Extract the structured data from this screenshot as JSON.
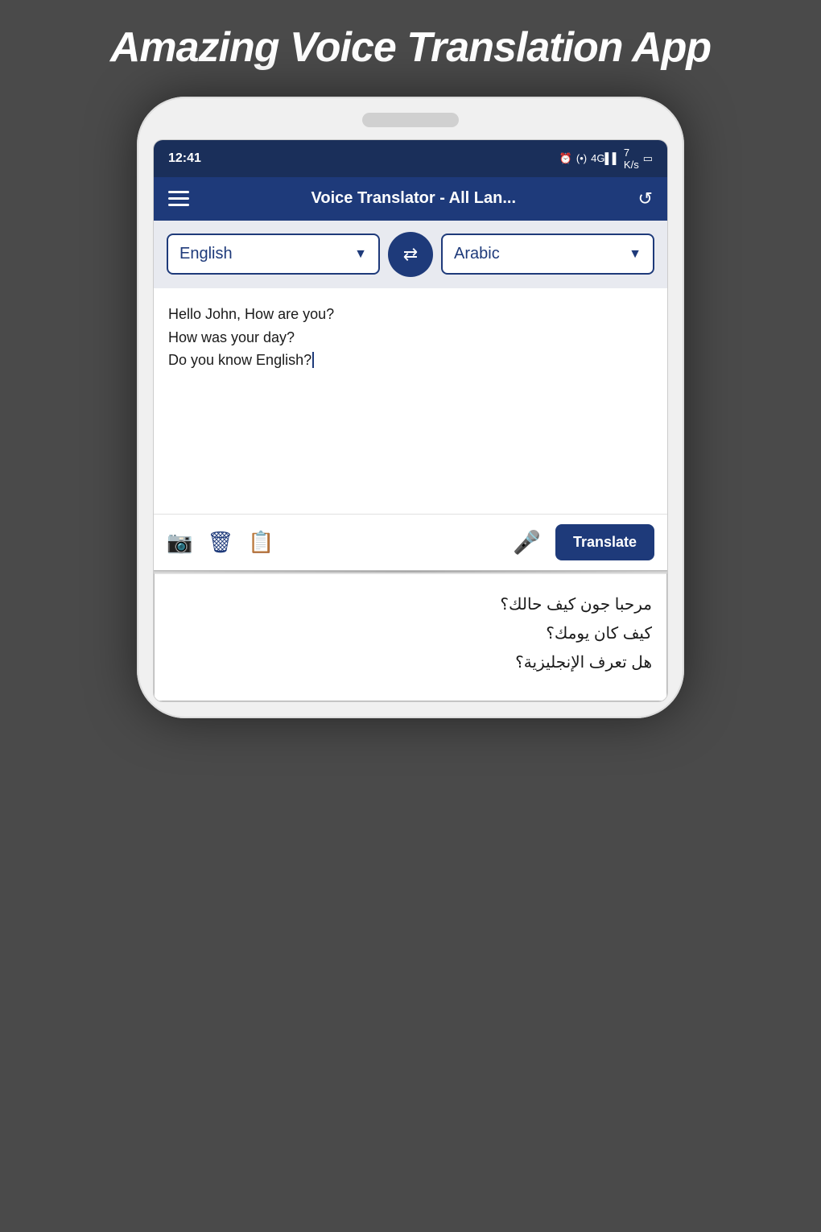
{
  "page": {
    "title": "Amazing Voice Translation App",
    "background_color": "#4a4a4a"
  },
  "status_bar": {
    "time": "12:41",
    "icons_text": "🕐 (•) 4G ▌▌▌ 7 K/s 🔋"
  },
  "app_bar": {
    "title": "Voice Translator - All Lan...",
    "menu_icon": "hamburger",
    "history_icon": "history"
  },
  "language_selector": {
    "source_language": "English",
    "target_language": "Arabic",
    "swap_button_label": "⇄"
  },
  "input_area": {
    "text_line1": "Hello John, How are you?",
    "text_line2": "How was your day?",
    "text_line3": "Do you know English?"
  },
  "toolbar": {
    "camera_label": "camera",
    "delete_label": "delete",
    "copy_label": "copy",
    "mic_label": "microphone",
    "translate_label": "Translate"
  },
  "output_area": {
    "line1": "مرحبا جون كيف حالك؟",
    "line2": "كيف كان يومك؟",
    "line3": "هل تعرف الإنجليزية؟"
  }
}
